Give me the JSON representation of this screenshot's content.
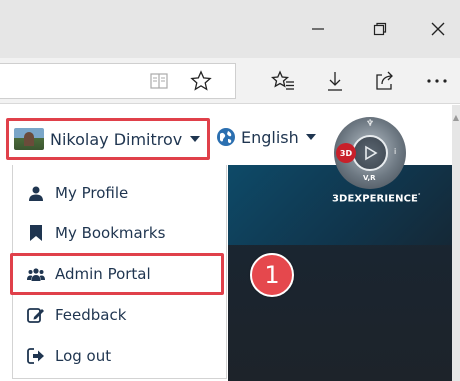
{
  "header": {
    "user_name": "Nikolay Dimitrov",
    "language": "English",
    "brand": "3DEXPERIENCE",
    "compass_left": "3D",
    "compass_bottom": "V,R",
    "compass_right": "i"
  },
  "menu": {
    "items": [
      {
        "label": "My Profile",
        "icon": "user-icon"
      },
      {
        "label": "My Bookmarks",
        "icon": "bookmark-icon"
      },
      {
        "label": "Admin Portal",
        "icon": "users-icon"
      },
      {
        "label": "Feedback",
        "icon": "edit-icon"
      },
      {
        "label": "Log out",
        "icon": "logout-icon"
      }
    ]
  },
  "annotation": {
    "step": "1",
    "accent_color": "#e0404a"
  },
  "browser": {
    "icons": [
      "reading-view-icon",
      "favorite-star-icon",
      "favorites-list-icon",
      "download-icon",
      "share-icon",
      "more-icon"
    ]
  }
}
